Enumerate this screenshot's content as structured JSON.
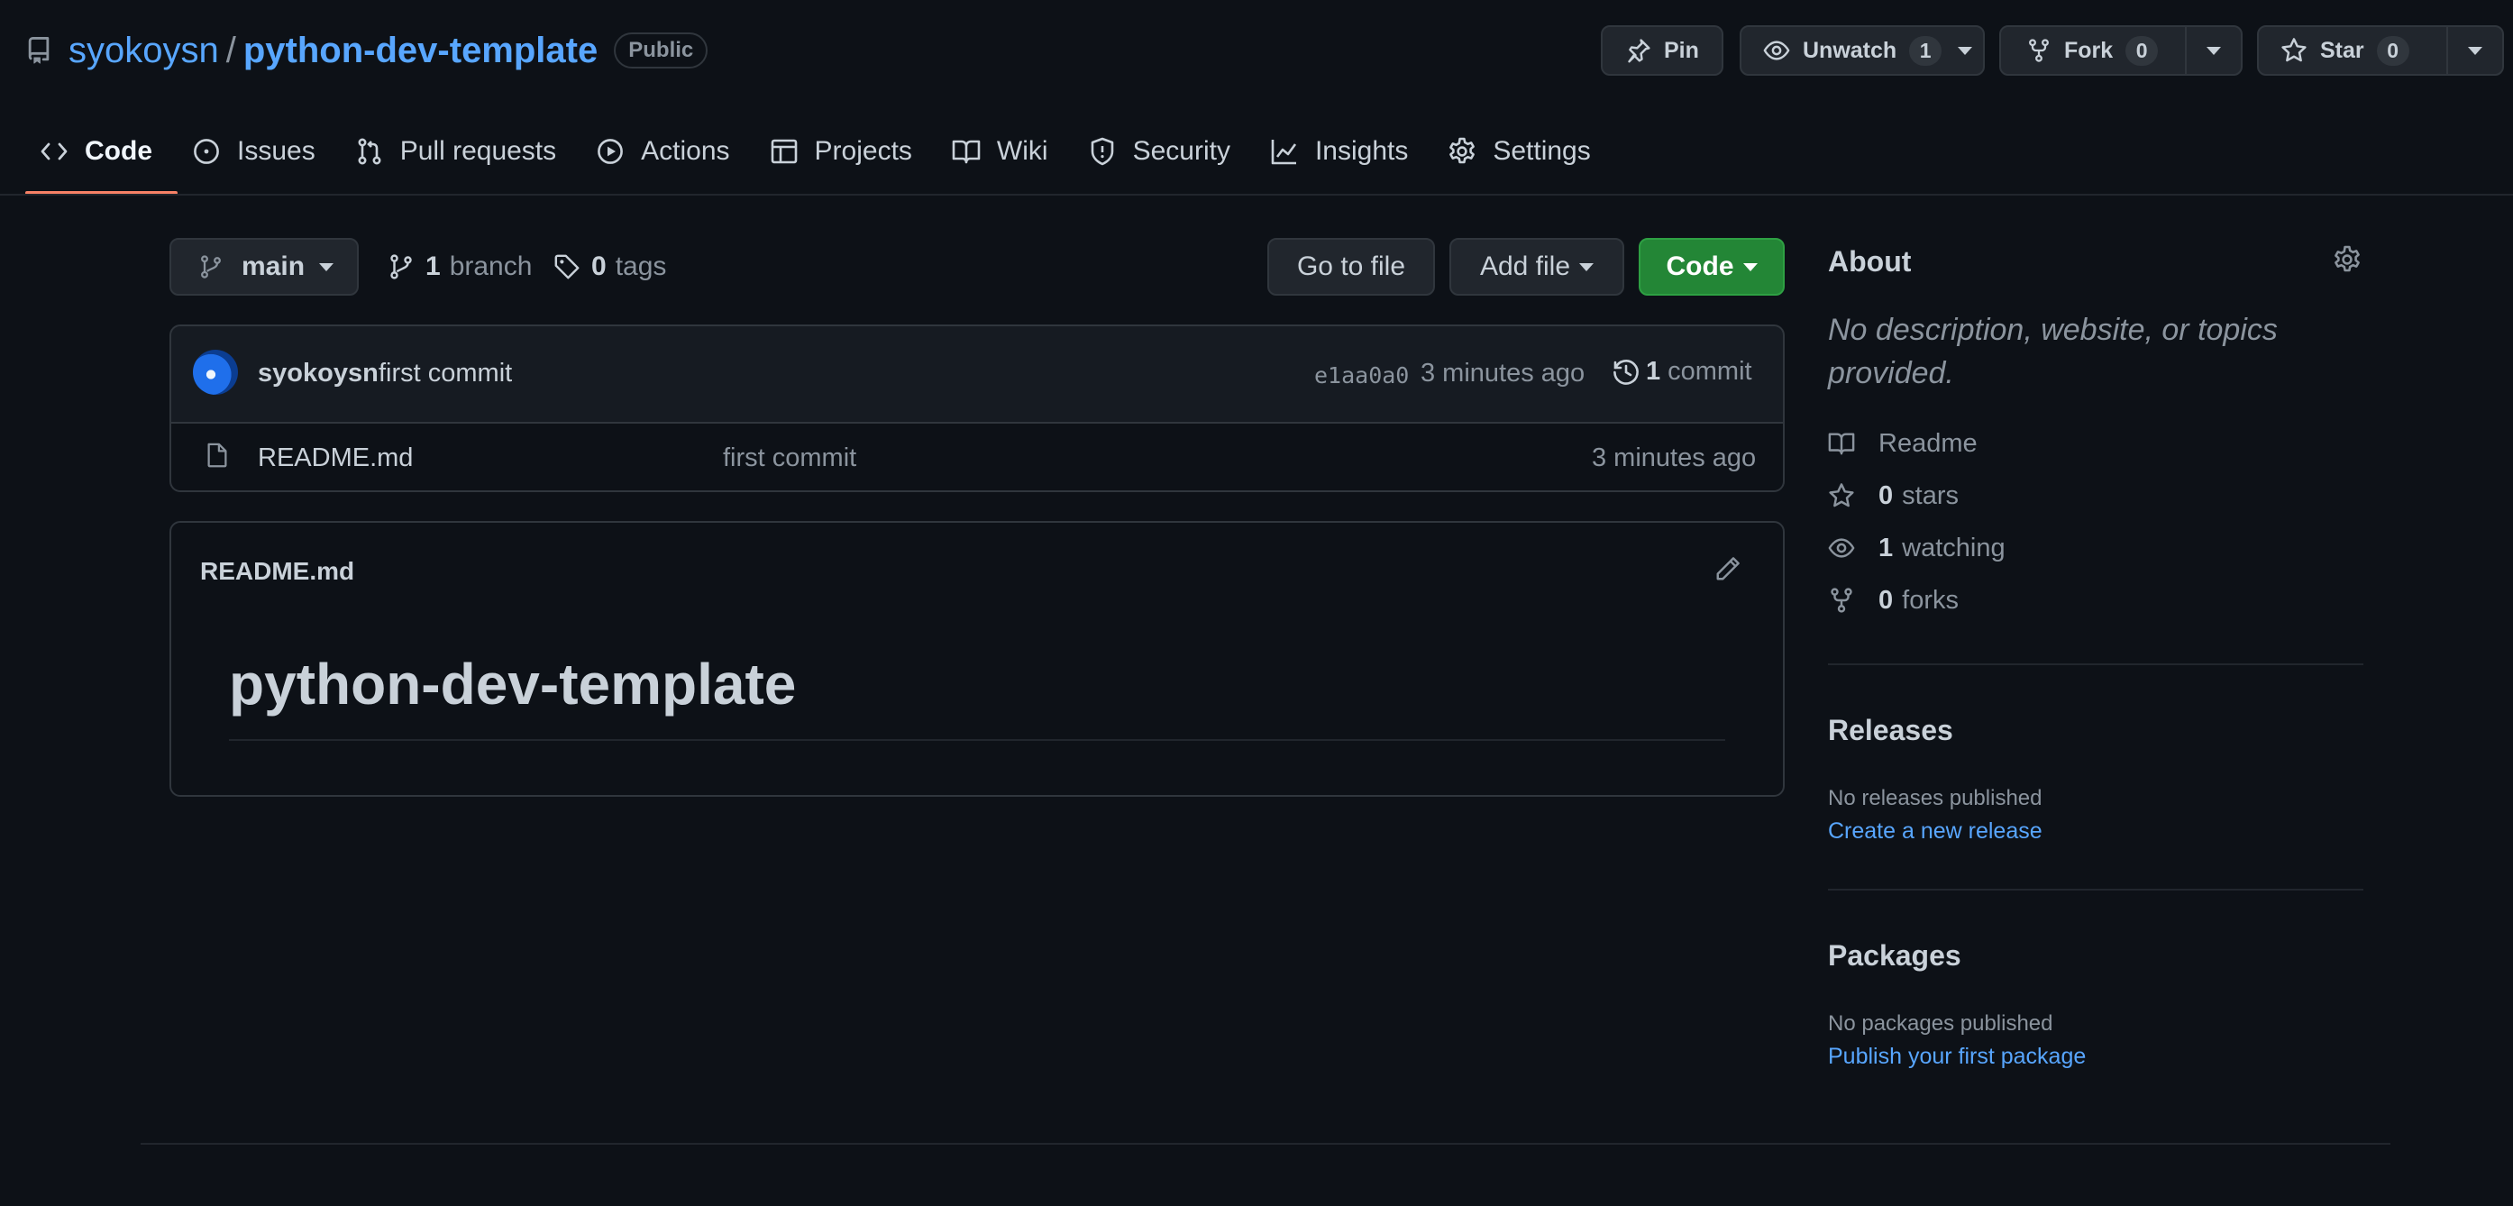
{
  "repo": {
    "owner": "syokoysn",
    "separator": "/",
    "name": "python-dev-template",
    "visibility": "Public"
  },
  "header_actions": {
    "pin_label": "Pin",
    "unwatch_label": "Unwatch",
    "unwatch_count": "1",
    "fork_label": "Fork",
    "fork_count": "0",
    "star_label": "Star",
    "star_count": "0"
  },
  "tabs": [
    {
      "label": "Code",
      "icon": "code-icon",
      "active": true
    },
    {
      "label": "Issues",
      "icon": "issue-icon"
    },
    {
      "label": "Pull requests",
      "icon": "pull-request-icon"
    },
    {
      "label": "Actions",
      "icon": "play-icon"
    },
    {
      "label": "Projects",
      "icon": "table-icon"
    },
    {
      "label": "Wiki",
      "icon": "book-icon"
    },
    {
      "label": "Security",
      "icon": "shield-icon"
    },
    {
      "label": "Insights",
      "icon": "graph-icon"
    },
    {
      "label": "Settings",
      "icon": "gear-icon"
    }
  ],
  "file_nav": {
    "branch": "main",
    "branch_count": "1",
    "branch_label": "branch",
    "tag_count": "0",
    "tag_label": "tags",
    "go_to_file": "Go to file",
    "add_file": "Add file",
    "code": "Code"
  },
  "latest_commit": {
    "author": "syokoysn",
    "message": "first commit",
    "sha": "e1aa0a0",
    "time": "3 minutes ago",
    "commit_count": "1",
    "commit_label": "commit"
  },
  "files": [
    {
      "name": "README.md",
      "message": "first commit",
      "time": "3 minutes ago",
      "icon": "file-icon"
    }
  ],
  "readme": {
    "title": "README.md",
    "heading": "python-dev-template"
  },
  "about": {
    "title": "About",
    "description": "No description, website, or topics provided.",
    "readme_label": "Readme",
    "stars_count": "0",
    "stars_label": "stars",
    "watching_count": "1",
    "watching_label": "watching",
    "forks_count": "0",
    "forks_label": "forks"
  },
  "releases": {
    "title": "Releases",
    "empty_text": "No releases published",
    "link": "Create a new release"
  },
  "packages": {
    "title": "Packages",
    "empty_text": "No packages published",
    "link": "Publish your first package"
  },
  "colors": {
    "background": "#0d1117",
    "link": "#58a6ff",
    "accent_underline": "#f78166",
    "green_button": "#238636"
  }
}
